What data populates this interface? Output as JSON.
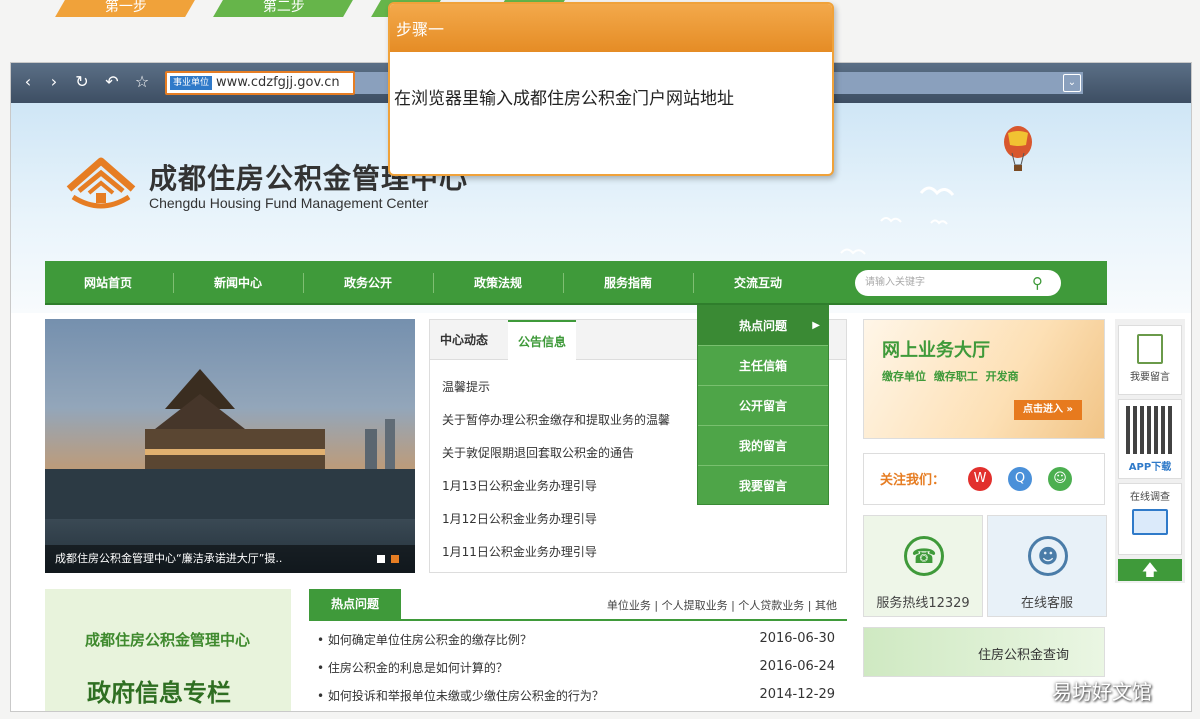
{
  "steps": {
    "tab1": "第一步",
    "tab2": "第二步"
  },
  "browser": {
    "url_tag": "事业单位",
    "url": "www.cdzfgjj.gov.cn"
  },
  "site": {
    "title": "成都住房公积金管理中心",
    "subtitle": "Chengdu Housing Fund Management Center"
  },
  "nav": {
    "items": [
      "网站首页",
      "新闻中心",
      "政务公开",
      "政策法规",
      "服务指南",
      "交流互动"
    ],
    "search_placeholder": "请输入关键字"
  },
  "dropdown": {
    "items": [
      "热点问题",
      "主任信箱",
      "公开留言",
      "我的留言",
      "我要留言"
    ]
  },
  "photo": {
    "caption": "成都住房公积金管理中心“廉洁承诺进大厅”摄.."
  },
  "news": {
    "tabs": [
      "中心动态",
      "公告信息"
    ],
    "items": [
      "温馨提示",
      "关于暂停办理公积金缴存和提取业务的温馨",
      "关于敦促限期退回套取公积金的通告",
      "1月13日公积金业务办理引导",
      "1月12日公积金业务办理引导",
      "1月11日公积金业务办理引导"
    ]
  },
  "hall": {
    "title": "网上业务大厅",
    "subtitle": "缴存单位  缴存职工  开发商",
    "button": "点击进入"
  },
  "follow": {
    "label": "关注我们："
  },
  "cards": {
    "hotline": "服务热线12329",
    "service": "在线客服"
  },
  "farright": {
    "leave_msg": "我要留言",
    "app": "APP下载",
    "survey": "在线调查"
  },
  "gov": {
    "line1": "成都住房公积金管理中心",
    "line2": "政府信息专栏"
  },
  "hot": {
    "tab": "热点问题",
    "categories": "单位业务  |  个人提取业务  |  个人贷款业务  |  其他",
    "items": [
      {
        "title": "• 如何确定单位住房公积金的缴存比例？",
        "date": "2016-06-30"
      },
      {
        "title": "• 住房公积金的利息是如何计算的？",
        "date": "2016-06-24"
      },
      {
        "title": "• 如何投诉和举报单位未缴或少缴住房公积金的行为？",
        "date": "2014-12-29"
      }
    ]
  },
  "query": {
    "label": "住房公积金查询"
  },
  "callout": {
    "header": "步骤一",
    "body": "在浏览器里输入成都住房公积金门户网站地址"
  },
  "watermark": "易坊好文馆",
  "colors": {
    "accent_orange": "#f0a23a",
    "nav_green": "#3f9a3a",
    "browser_bar": "#4a5d74"
  }
}
